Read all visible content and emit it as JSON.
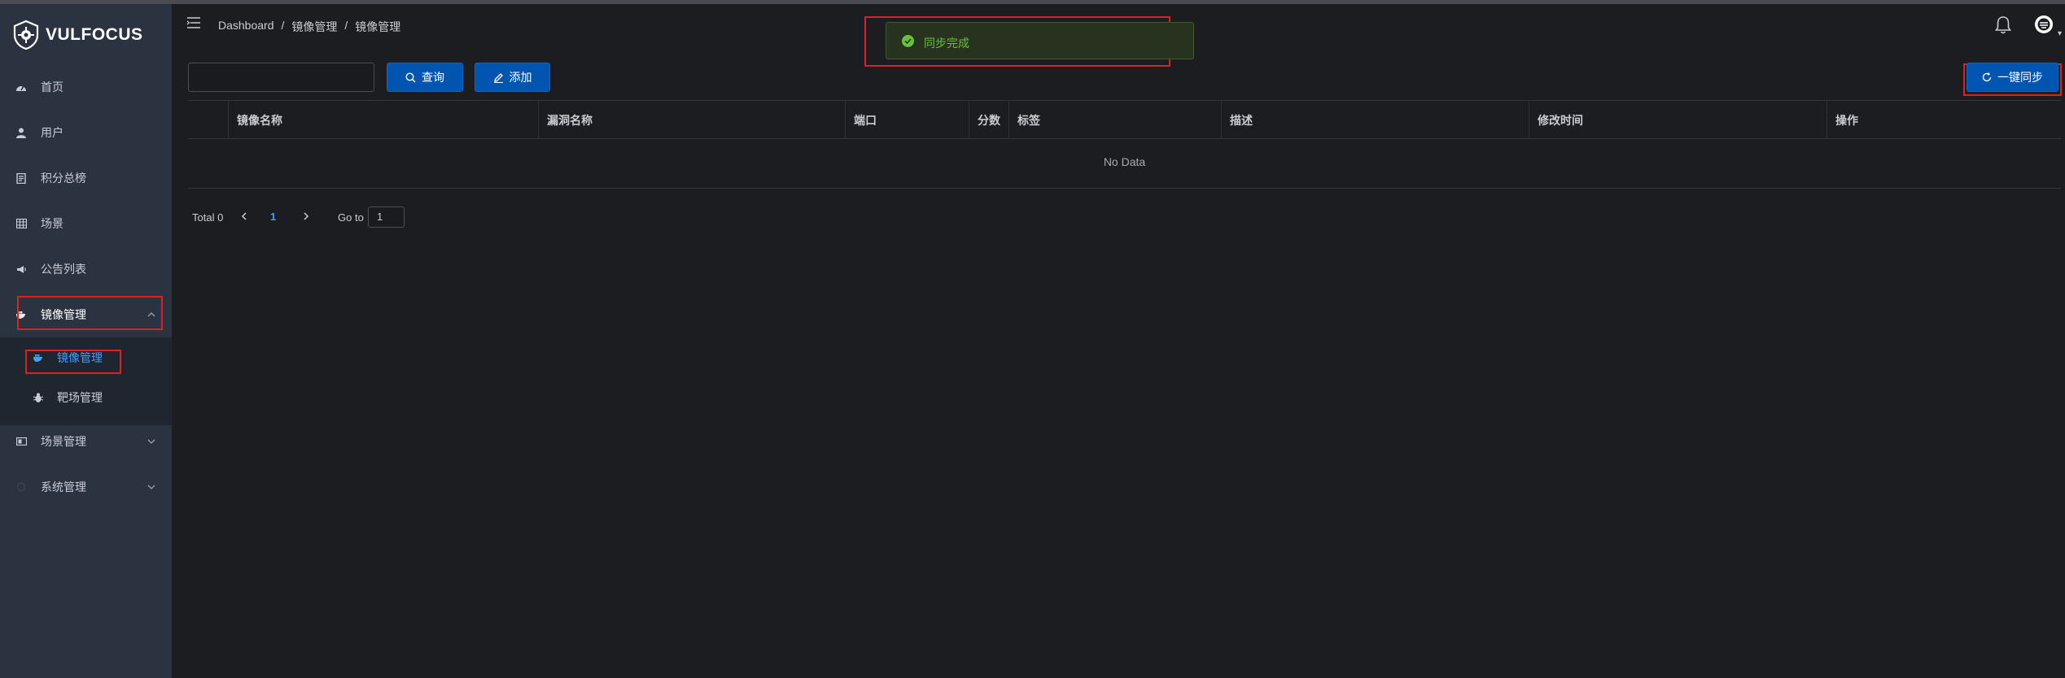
{
  "app": {
    "logo_text": "VULFOCUS"
  },
  "sidebar": {
    "items": [
      {
        "label": "首页",
        "icon": "dashboard-icon"
      },
      {
        "label": "用户",
        "icon": "user-icon"
      },
      {
        "label": "积分总榜",
        "icon": "document-icon"
      },
      {
        "label": "场景",
        "icon": "grid-icon"
      },
      {
        "label": "公告列表",
        "icon": "megaphone-icon"
      },
      {
        "label": "镜像管理",
        "icon": "docker-icon",
        "expanded": true
      },
      {
        "label": "场景管理",
        "icon": "scene-icon"
      },
      {
        "label": "系统管理",
        "icon": "settings-icon"
      }
    ],
    "submenu": [
      {
        "label": "镜像管理",
        "icon": "docker-icon",
        "active": true
      },
      {
        "label": "靶场管理",
        "icon": "bug-icon"
      }
    ]
  },
  "breadcrumb": [
    "Dashboard",
    "镜像管理",
    "镜像管理"
  ],
  "toast": {
    "message": "同步完成",
    "type": "success"
  },
  "toolbar": {
    "search_value": "",
    "search_placeholder": "",
    "query_label": "查询",
    "add_label": "添加",
    "sync_label": "一键同步"
  },
  "table": {
    "columns": [
      "",
      "镜像名称",
      "漏洞名称",
      "端口",
      "分数",
      "标签",
      "描述",
      "修改时间",
      "操作"
    ],
    "empty_text": "No Data"
  },
  "pagination": {
    "total_label": "Total 0",
    "current_page": "1",
    "goto_label": "Go to",
    "goto_value": "1"
  },
  "colors": {
    "sidebar_bg": "#2b3340",
    "content_bg": "#1c1d20",
    "primary": "#0055b0",
    "active_link": "#409eff",
    "success": "#67c23a",
    "highlight_box": "#e02020"
  }
}
